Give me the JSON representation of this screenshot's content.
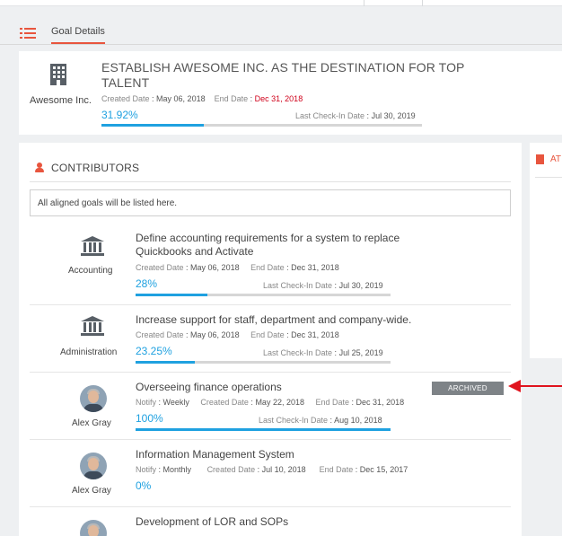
{
  "tab": {
    "label": "Goal Details"
  },
  "goal": {
    "owner": "Awesome Inc.",
    "title": "ESTABLISH AWESOME INC. AS THE DESTINATION FOR TOP TALENT",
    "created_label": "Created Date",
    "created": "May 06, 2018",
    "end_label": "End Date",
    "end": "Dec 31, 2018",
    "progress": "31.92%",
    "progress_value": 31.92,
    "checkin_label": "Last Check-In Date",
    "checkin": "Jul 30, 2019"
  },
  "contributors": {
    "title": "CONTRIBUTORS",
    "notice": "All aligned goals will be listed here.",
    "rows": [
      {
        "owner": "Accounting",
        "icon": "bank-icon",
        "title": "Define accounting requirements for a system to replace Quickbooks and Activate",
        "created": "May 06, 2018",
        "end": "Dec 31, 2018",
        "progress": "28%",
        "progress_value": 28,
        "checkin": "Jul 30, 2019"
      },
      {
        "owner": "Administration",
        "icon": "bank-icon",
        "title": "Increase support for staff, department and company-wide.",
        "created": "May 06, 2018",
        "end": "Dec 31, 2018",
        "progress": "23.25%",
        "progress_value": 23.25,
        "checkin": "Jul 25, 2019"
      },
      {
        "owner": "Alex Gray",
        "icon": "avatar",
        "title": "Overseeing finance operations",
        "notify": "Weekly",
        "created": "May 22, 2018",
        "end": "Dec 31, 2018",
        "progress": "100%",
        "progress_value": 100,
        "checkin": "Aug 10, 2018",
        "badge": "ARCHIVED"
      },
      {
        "owner": "Alex Gray",
        "icon": "avatar",
        "title": "Information Management System",
        "notify": "Monthly",
        "created": "Jul 10, 2018",
        "end": "Dec 15, 2017",
        "progress": "0%",
        "progress_value": 0
      },
      {
        "owner": "",
        "icon": "avatar",
        "title": "Development of LOR and SOPs"
      }
    ],
    "labels": {
      "created": "Created Date",
      "end": "End Date",
      "checkin": "Last Check-In Date",
      "notify": "Notify"
    }
  },
  "attachments": {
    "label": "AT"
  },
  "colors": {
    "accent": "#e8553e",
    "progress": "#1fa1e0",
    "overdue": "#d0021b",
    "badge": "#7e8387"
  }
}
